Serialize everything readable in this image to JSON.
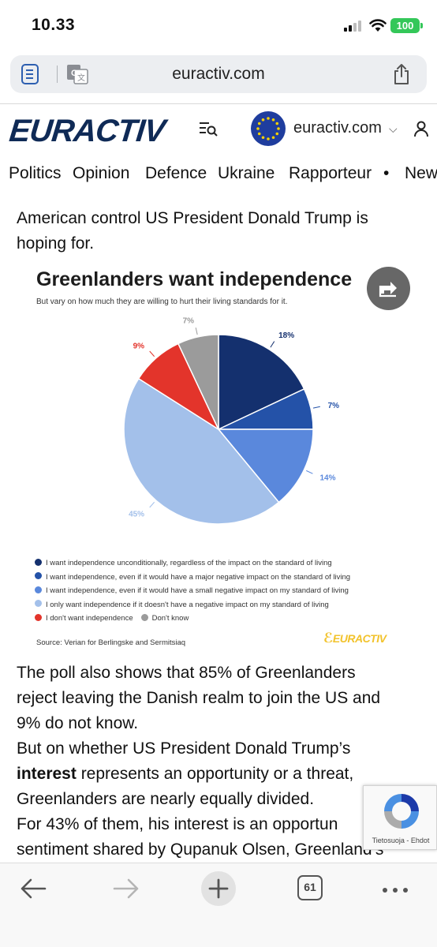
{
  "status_bar": {
    "time": "10.33",
    "battery": "100"
  },
  "browser": {
    "url": "euractiv.com"
  },
  "site": {
    "logo": "EURACTIV",
    "edition": "euractiv.com"
  },
  "nav": {
    "items": [
      "Politics",
      "Opinion",
      "Defence",
      "Ukraine",
      "Rapporteur",
      "•",
      "New"
    ]
  },
  "article": {
    "lead_lines": [
      "American control US President Donald Trump is",
      "hoping for."
    ],
    "p1_lines": [
      "The poll also shows that 85% of Greenlanders",
      "reject leaving the Danish realm to join the US and",
      "9% do not know."
    ],
    "p2_line1": "But on whether US President Donald Trump’s",
    "p2_link": "interest",
    "p2_line2_rest": " represents an opportunity or a threat,",
    "p2_line3": "Greenlanders are nearly equally divided.",
    "p3_lines": [
      "For 43% of them, his interest is an opportun",
      "sentiment shared by Qupanuk Olsen, Greenland’s"
    ]
  },
  "chart_data": {
    "type": "pie",
    "title": "Greenlanders want independence",
    "subtitle": "But vary on how much they are willing to hurt their living standards for it.",
    "slices": [
      {
        "label": "I want independence unconditionally, regardless of the impact on the standard of living",
        "value": 18,
        "display": "18%",
        "color": "#14306e"
      },
      {
        "label": "I want independence, even if it would have a major negative impact on the standard of living",
        "value": 7,
        "display": "7%",
        "color": "#2452a8"
      },
      {
        "label": "I want independence, even if it would have a small negative impact on my standard of living",
        "value": 14,
        "display": "14%",
        "color": "#5a88dc"
      },
      {
        "label": "I only want independence if it doesn't have a negative impact on my standard of living",
        "value": 45,
        "display": "45%",
        "color": "#a3c0ea"
      },
      {
        "label": "I don't want independence",
        "value": 9,
        "display": "9%",
        "color": "#e3342b"
      },
      {
        "label": "Don't know",
        "value": 7,
        "display": "7%",
        "color": "#9b9b9b"
      }
    ],
    "source": "Source: Verian for Berlingske and Sermitsiaq",
    "brand": "EURACTIV"
  },
  "recaptcha": {
    "links": "Tietosuoja - Ehdot"
  },
  "toolbar": {
    "tab_count": "61"
  }
}
